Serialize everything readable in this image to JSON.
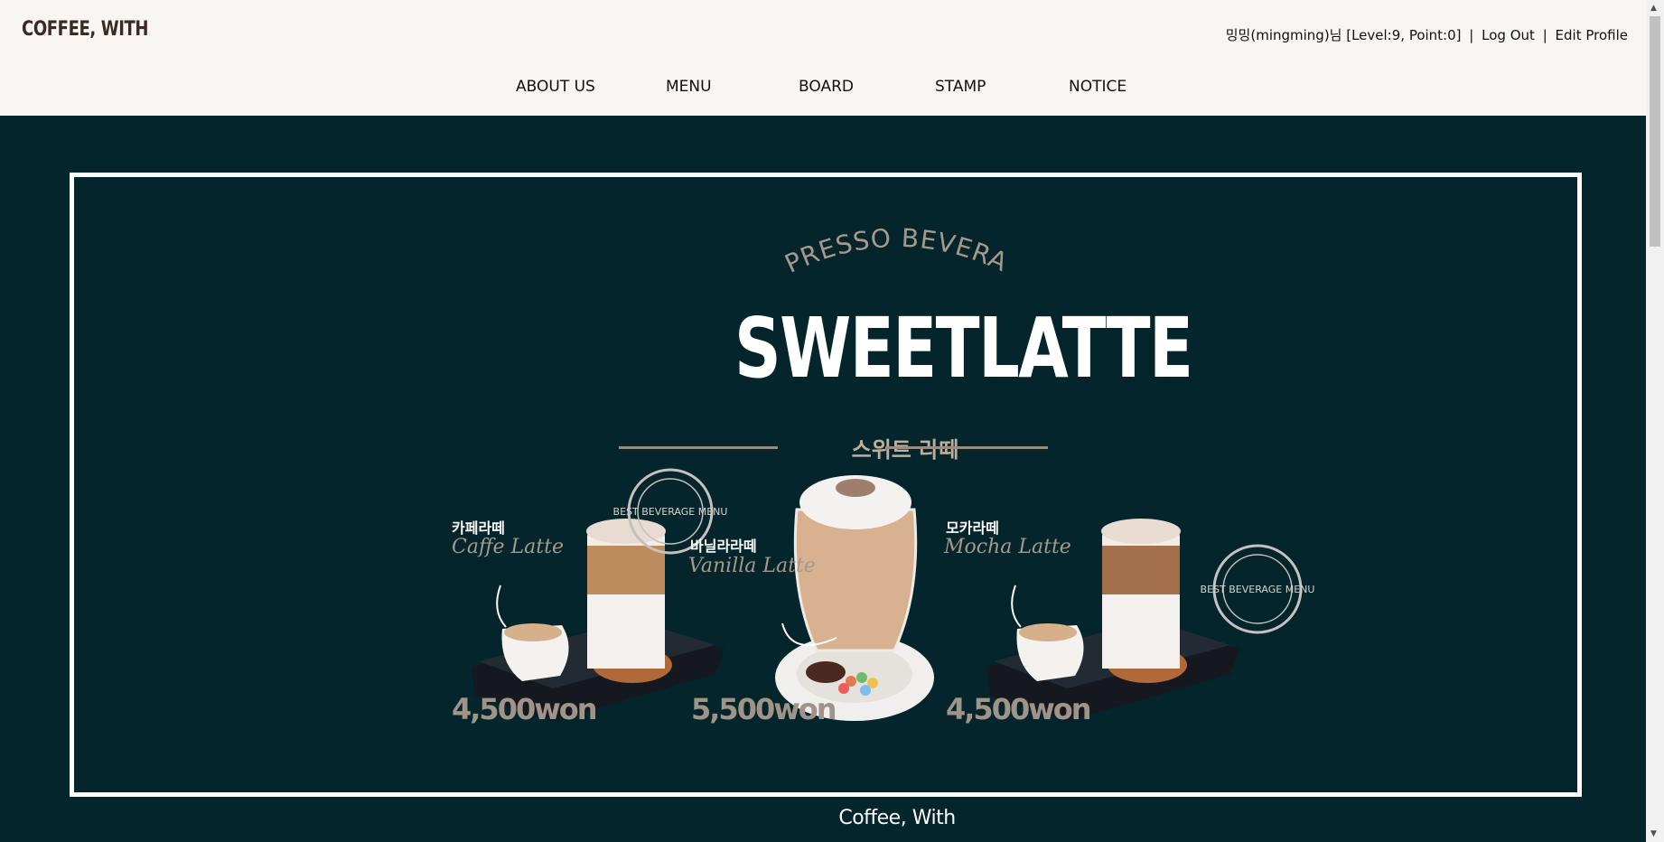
{
  "header": {
    "logo": "COFFEE, WITH",
    "user_info": "밍밍(mingming)님 [Level:9, Point:0]",
    "sep": "|",
    "logout": "Log Out",
    "edit_profile": "Edit Profile"
  },
  "nav": [
    {
      "label": "ABOUT US"
    },
    {
      "label": "MENU"
    },
    {
      "label": "BOARD"
    },
    {
      "label": "STAMP"
    },
    {
      "label": "NOTICE"
    }
  ],
  "banner": {
    "arc_text": "ESPRESSO BEVERAGE",
    "title": "SWEETLATTE",
    "subtitle_ko": "스위트 라떼",
    "items": [
      {
        "name_ko": "카페라떼",
        "name_en": "Caffe Latte",
        "price": "4,500won"
      },
      {
        "name_ko": "바닐라라떼",
        "name_en": "Vanilla Latte",
        "price": "5,500won"
      },
      {
        "name_ko": "모카라떼",
        "name_en": "Mocha Latte",
        "price": "4,500won"
      }
    ],
    "footer": "Coffee, With",
    "stamp_text": "BEST BEVERAGE MENU"
  },
  "colors": {
    "hero_bg": "#03252b",
    "header_bg": "#f8f5f2",
    "accent_tan": "#a09488"
  }
}
